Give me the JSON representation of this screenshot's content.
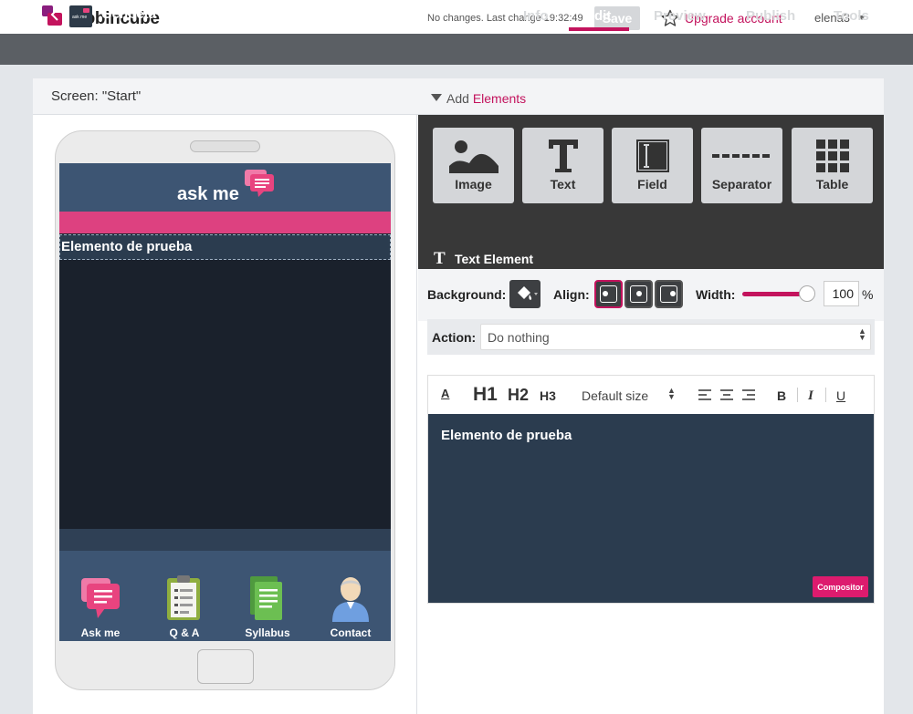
{
  "header": {
    "brand": "mobincube",
    "status": "No changes. Last change 19:32:49",
    "save_label": "Save",
    "upgrade_label": "Upgrade account",
    "user": "elena3"
  },
  "nav": {
    "app_name": "Genbeta",
    "app_icon_text": "ask me",
    "tabs": [
      "Info",
      "Edit",
      "Preview",
      "Publish",
      "Tools"
    ],
    "active_tab": "Edit"
  },
  "panel": {
    "screen_title": "Screen: \"Start\"",
    "add_prefix": "Add",
    "add_suffix": "Elements"
  },
  "phone": {
    "logo_text": "ask me",
    "text_element": "Elemento de prueba",
    "tabs": [
      "Ask me",
      "Q & A",
      "Syllabus",
      "Contact"
    ]
  },
  "elements": {
    "buttons": [
      "Image",
      "Text",
      "Field",
      "Separator",
      "Table"
    ]
  },
  "text_element": {
    "title": "Text Element",
    "background_label": "Background:",
    "align_label": "Align:",
    "width_label": "Width:",
    "width_value": "100",
    "width_unit": "%",
    "width_fraction": 1.0,
    "action_label": "Action:",
    "action_value": "Do nothing",
    "active_align": "left"
  },
  "editor": {
    "h1": "H1",
    "h2": "H2",
    "h3": "H3",
    "font_size": "Default size",
    "content": "Elemento de prueba",
    "compositor_label": "Compositor"
  },
  "colors": {
    "accent": "#c3135d",
    "nav_bg": "#5b5f64",
    "phone_header": "#3d5573",
    "phone_stripe": "#dd4180",
    "editor_bg": "#2b3c4f"
  }
}
